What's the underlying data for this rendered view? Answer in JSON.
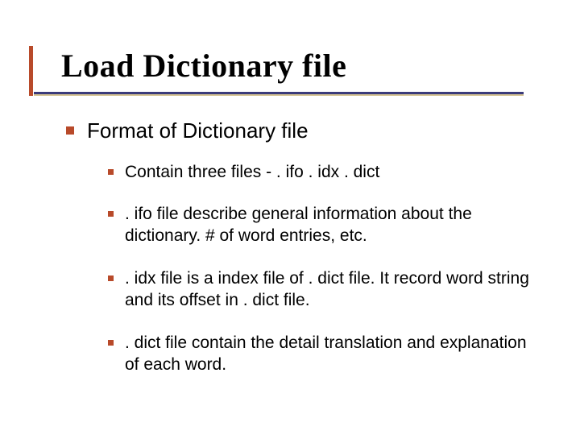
{
  "title": "Load Dictionary file",
  "level1": {
    "text": "Format of Dictionary file"
  },
  "level2": [
    {
      "text": "Contain three files - . ifo . idx . dict"
    },
    {
      "text": ". ifo file describe general information about the dictionary. # of word entries, etc."
    },
    {
      "text": ". idx file is a index file of . dict file. It record word string and its offset in . dict file."
    },
    {
      "text": ". dict file contain the detail translation and explanation of each word."
    }
  ]
}
